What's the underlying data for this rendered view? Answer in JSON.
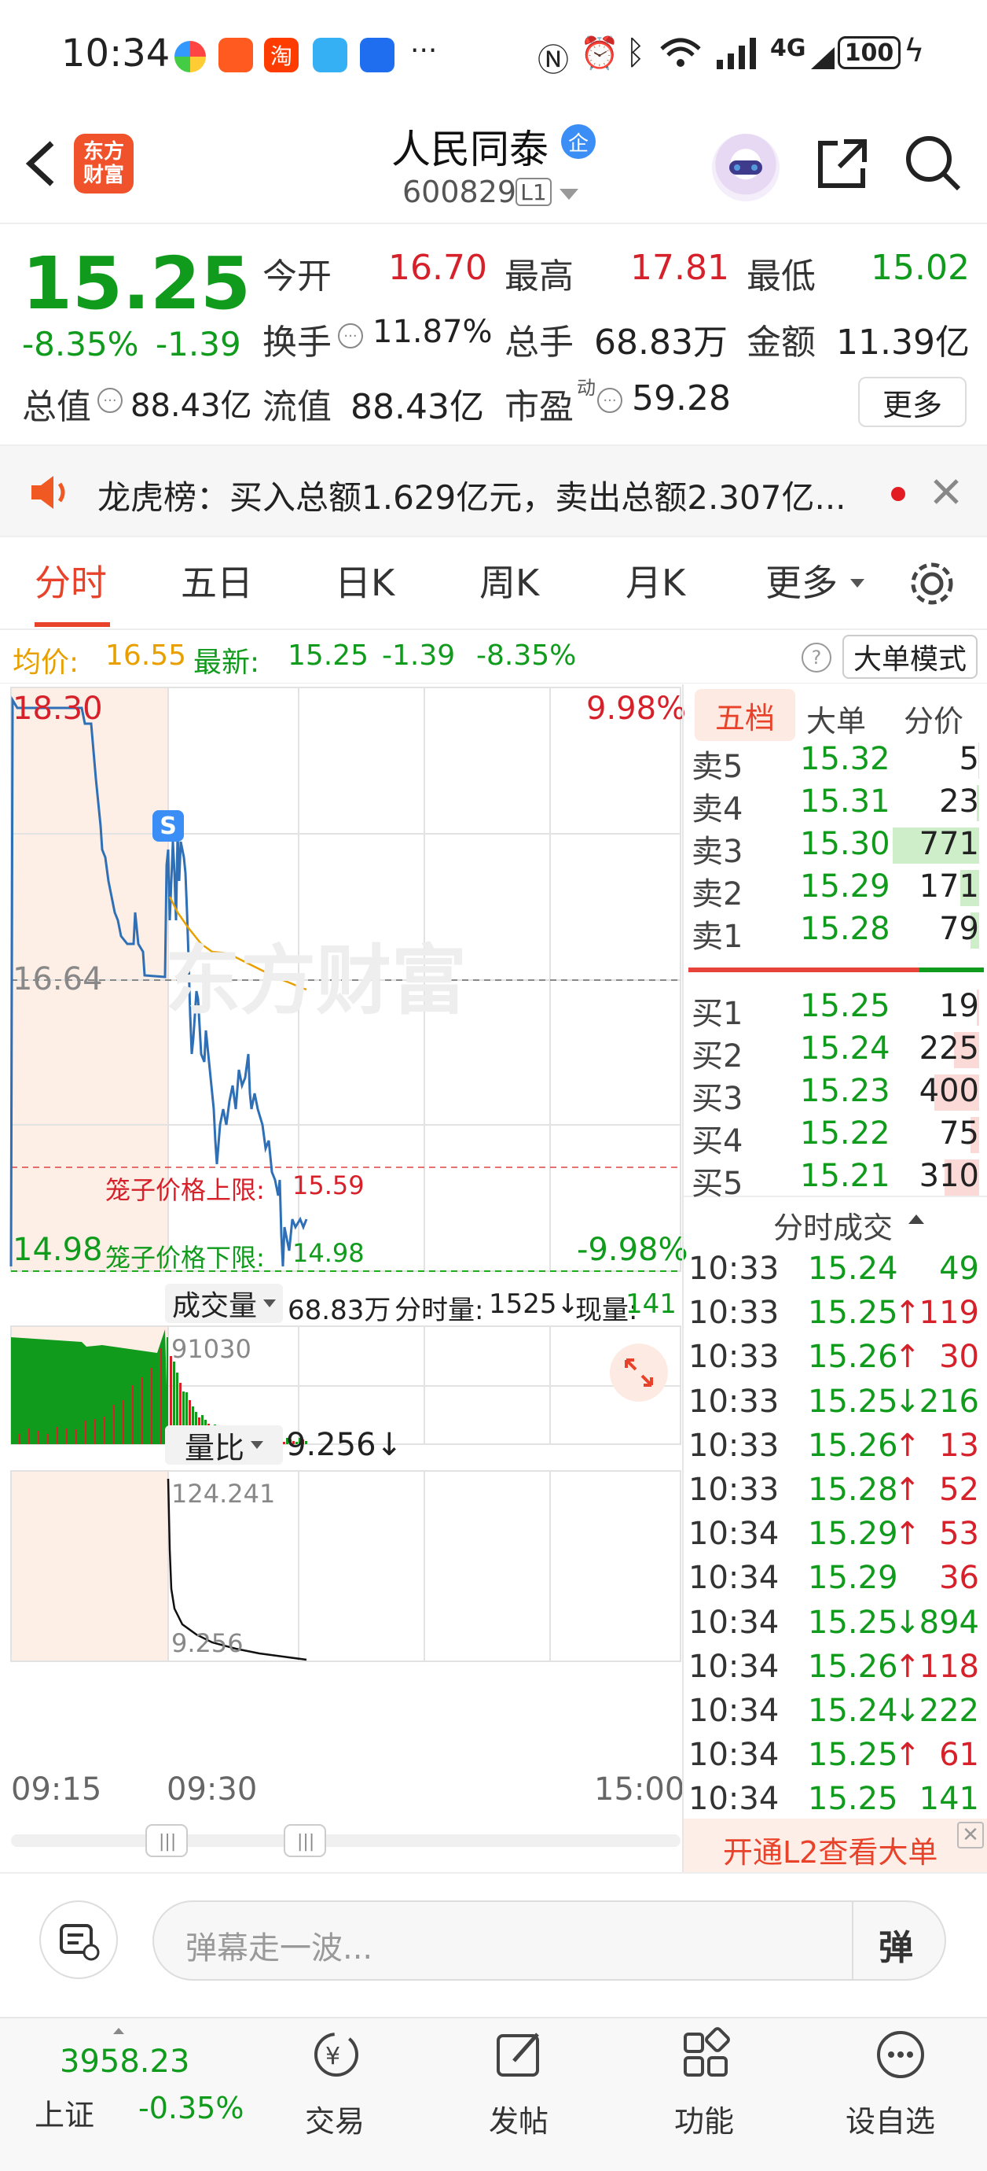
{
  "status": {
    "time": "10:34",
    "battery": "100"
  },
  "header": {
    "title": "人民同泰",
    "tag": "企",
    "code": "600829",
    "level": "L1"
  },
  "quote": {
    "price": "15.25",
    "pct": "-8.35%",
    "chg": "-1.39",
    "open_label": "今开",
    "open": "16.70",
    "high_label": "最高",
    "high": "17.81",
    "low_label": "最低",
    "low": "15.02",
    "turnover_label": "换手",
    "turnover": "11.87%",
    "vol_label": "总手",
    "vol": "68.83万",
    "amt_label": "金额",
    "amt": "11.39亿",
    "mcap_label": "总值",
    "mcap": "88.43亿",
    "float_label": "流值",
    "float": "88.43亿",
    "pe_label": "市盈",
    "pe_sup": "动",
    "pe": "59.28",
    "more": "更多"
  },
  "notice": {
    "text": "龙虎榜：买入总额1.629亿元，卖出总额2.307亿..."
  },
  "tabs": [
    "分时",
    "五日",
    "日K",
    "周K",
    "月K",
    "更多"
  ],
  "info": {
    "avg_label": "均价:",
    "avg": "16.55",
    "latest_label": "最新:",
    "latest": "15.25",
    "chg": "-1.39",
    "pct": "-8.35%",
    "mode": "大单模式"
  },
  "chart": {
    "high": "18.30",
    "high_pct": "9.98%",
    "mid": "16.64",
    "low": "14.98",
    "low_pct": "-9.98%",
    "s_marker": "S",
    "cage_upper_label": "笼子价格上限:",
    "cage_upper": "15.59",
    "cage_lower_label": "笼子价格下限:",
    "cage_lower": "14.98",
    "watermark": "东方财富"
  },
  "volume": {
    "label": "成交量",
    "total": "68.83万",
    "minute_label": "分时量:",
    "minute": "1525↓",
    "now_label": "现量:",
    "now": "141",
    "max": "91030"
  },
  "ratio": {
    "label": "量比",
    "value": "9.256↓",
    "max": "124.241",
    "min": "9.256"
  },
  "time_axis": [
    "09:15",
    "09:30",
    "15:00"
  ],
  "orderbook": {
    "tabs": [
      "五档",
      "大单",
      "分价"
    ],
    "asks": [
      {
        "label": "卖5",
        "price": "15.32",
        "vol": "5"
      },
      {
        "label": "卖4",
        "price": "15.31",
        "vol": "23"
      },
      {
        "label": "卖3",
        "price": "15.30",
        "vol": "771"
      },
      {
        "label": "卖2",
        "price": "15.29",
        "vol": "171"
      },
      {
        "label": "卖1",
        "price": "15.28",
        "vol": "79"
      }
    ],
    "bids": [
      {
        "label": "买1",
        "price": "15.25",
        "vol": "19"
      },
      {
        "label": "买2",
        "price": "15.24",
        "vol": "225"
      },
      {
        "label": "买3",
        "price": "15.23",
        "vol": "400"
      },
      {
        "label": "买4",
        "price": "15.22",
        "vol": "75"
      },
      {
        "label": "买5",
        "price": "15.21",
        "vol": "310"
      }
    ]
  },
  "trades": {
    "title": "分时成交",
    "rows": [
      {
        "t": "10:33",
        "p": "15.24",
        "a": "",
        "v": "49",
        "pc": "green",
        "vc": "green"
      },
      {
        "t": "10:33",
        "p": "15.25",
        "a": "↑",
        "v": "119",
        "pc": "green",
        "vc": "red"
      },
      {
        "t": "10:33",
        "p": "15.26",
        "a": "↑",
        "v": "30",
        "pc": "green",
        "vc": "red"
      },
      {
        "t": "10:33",
        "p": "15.25",
        "a": "↓",
        "v": "216",
        "pc": "green",
        "vc": "green"
      },
      {
        "t": "10:33",
        "p": "15.26",
        "a": "↑",
        "v": "13",
        "pc": "green",
        "vc": "red"
      },
      {
        "t": "10:33",
        "p": "15.28",
        "a": "↑",
        "v": "52",
        "pc": "green",
        "vc": "red"
      },
      {
        "t": "10:34",
        "p": "15.29",
        "a": "↑",
        "v": "53",
        "pc": "green",
        "vc": "red"
      },
      {
        "t": "10:34",
        "p": "15.29",
        "a": "",
        "v": "36",
        "pc": "green",
        "vc": "red"
      },
      {
        "t": "10:34",
        "p": "15.25",
        "a": "↓",
        "v": "894",
        "pc": "green",
        "vc": "green"
      },
      {
        "t": "10:34",
        "p": "15.26",
        "a": "↑",
        "v": "118",
        "pc": "green",
        "vc": "red"
      },
      {
        "t": "10:34",
        "p": "15.24",
        "a": "↓",
        "v": "222",
        "pc": "green",
        "vc": "green"
      },
      {
        "t": "10:34",
        "p": "15.25",
        "a": "↑",
        "v": "61",
        "pc": "green",
        "vc": "red"
      },
      {
        "t": "10:34",
        "p": "15.25",
        "a": "",
        "v": "141",
        "pc": "green",
        "vc": "green"
      }
    ],
    "l2": "开通L2查看大单"
  },
  "comment": {
    "placeholder": "弹幕走一波...",
    "danmu": "弹"
  },
  "bottom": {
    "index_value": "3958.23",
    "index_name": "上证",
    "index_pct": "-0.35%",
    "items": [
      {
        "label": "交易",
        "icon": "trade-icon"
      },
      {
        "label": "发帖",
        "icon": "post-icon"
      },
      {
        "label": "功能",
        "icon": "function-icon"
      },
      {
        "label": "设自选",
        "icon": "add-watchlist-icon"
      }
    ]
  },
  "colors": {
    "up": "#d6212b",
    "down": "#109b1d",
    "accent": "#e8432a"
  }
}
